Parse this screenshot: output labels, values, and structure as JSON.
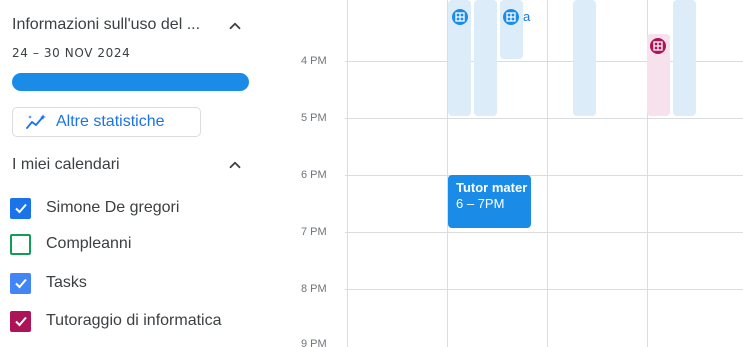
{
  "sidebar": {
    "insights": {
      "title": "Informazioni sull'uso del ...",
      "date_range": "24 – 30 NOV 2024",
      "progress_fraction": 1.0,
      "button_label": "Altre statistiche"
    },
    "calendars": {
      "title": "I miei calendari",
      "items": [
        {
          "label": "Simone De gregori",
          "checked": true,
          "color": "#1a73e8"
        },
        {
          "label": "Compleanni",
          "checked": false,
          "color": "#0f9d58"
        },
        {
          "label": "Tasks",
          "checked": true,
          "color": "#4285f4"
        },
        {
          "label": "Tutoraggio di informatica",
          "checked": true,
          "color": "#ad1457"
        }
      ]
    }
  },
  "grid": {
    "hours": [
      "4 PM",
      "5 PM",
      "6 PM",
      "7 PM",
      "8 PM",
      "9 PM"
    ],
    "event": {
      "title": "Tutor mater",
      "time": "6 – 7PM",
      "color": "#1a8ce8"
    },
    "task_badge_text": "a"
  },
  "colors": {
    "accent": "#1a73e8",
    "block_blue": "#dcedf9",
    "block_pink": "#f7e1ec",
    "tutoraggio": "#ad1457"
  },
  "icons": {
    "chevron": "chevron-up-icon",
    "stats": "sparkle-chart-icon",
    "task": "grid-icon"
  }
}
